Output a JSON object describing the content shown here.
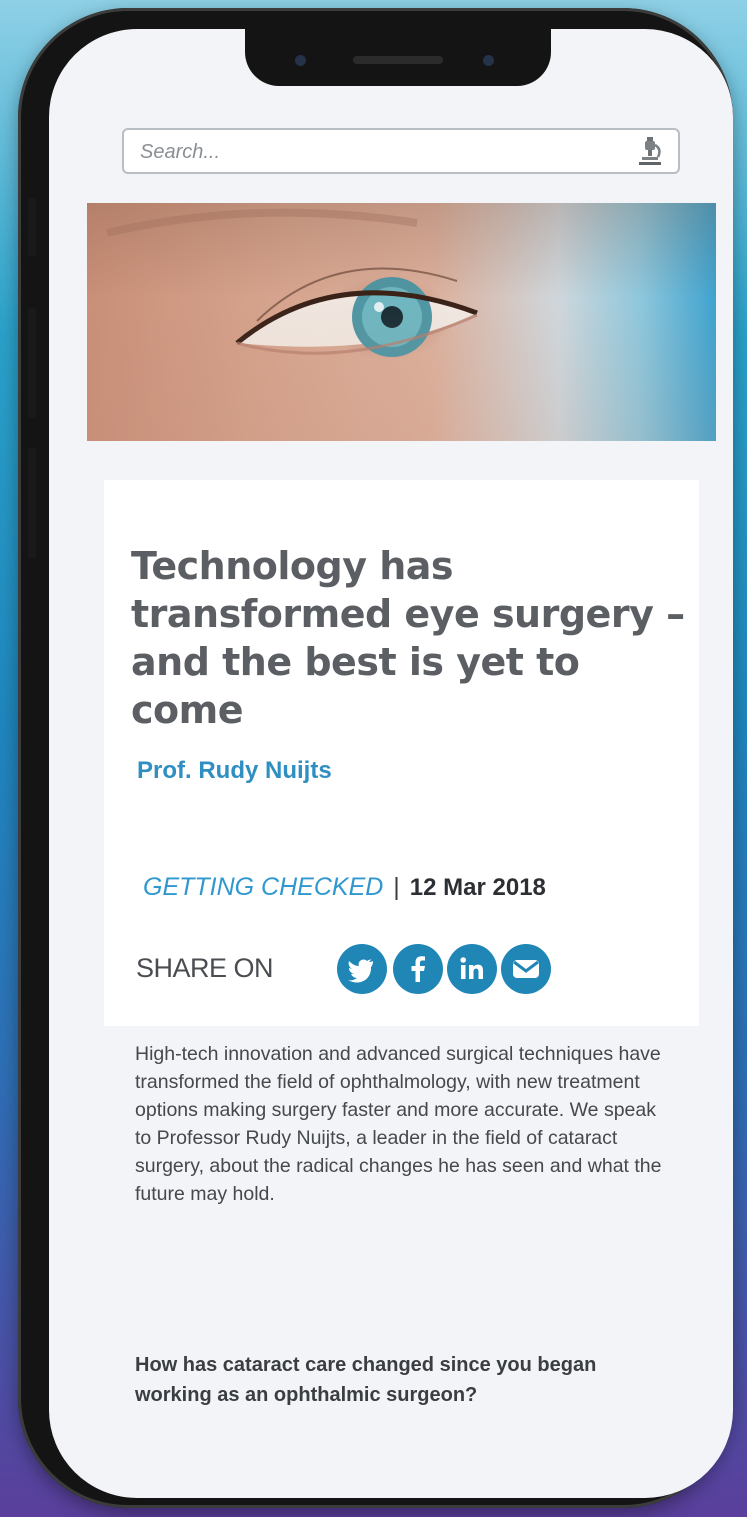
{
  "search": {
    "placeholder": "Search..."
  },
  "icons": {
    "search_button": "microscope-icon",
    "share": [
      "twitter-icon",
      "facebook-icon",
      "linkedin-icon",
      "email-icon"
    ]
  },
  "article": {
    "title": "Technology has transformed eye surgery – and the best is yet to come",
    "author": "Prof. Rudy Nuijts",
    "category": "GETTING CHECKED",
    "separator": "|",
    "date": "12 Mar 2018",
    "share_label": "SHARE ON",
    "lead": "High-tech innovation and advanced surgical techniques have transformed the field of ophthalmology, with new treatment options making surgery faster and more accurate. We speak to Professor Rudy Nuijts, a leader in the field of cataract surgery, about the radical changes he has seen and what the future may hold.",
    "question": "How has cataract care changed since you began working as an ophthalmic surgeon?"
  },
  "colors": {
    "accent": "#2f8fc2",
    "share_button": "#1f86b6",
    "title": "#5b5e62"
  }
}
